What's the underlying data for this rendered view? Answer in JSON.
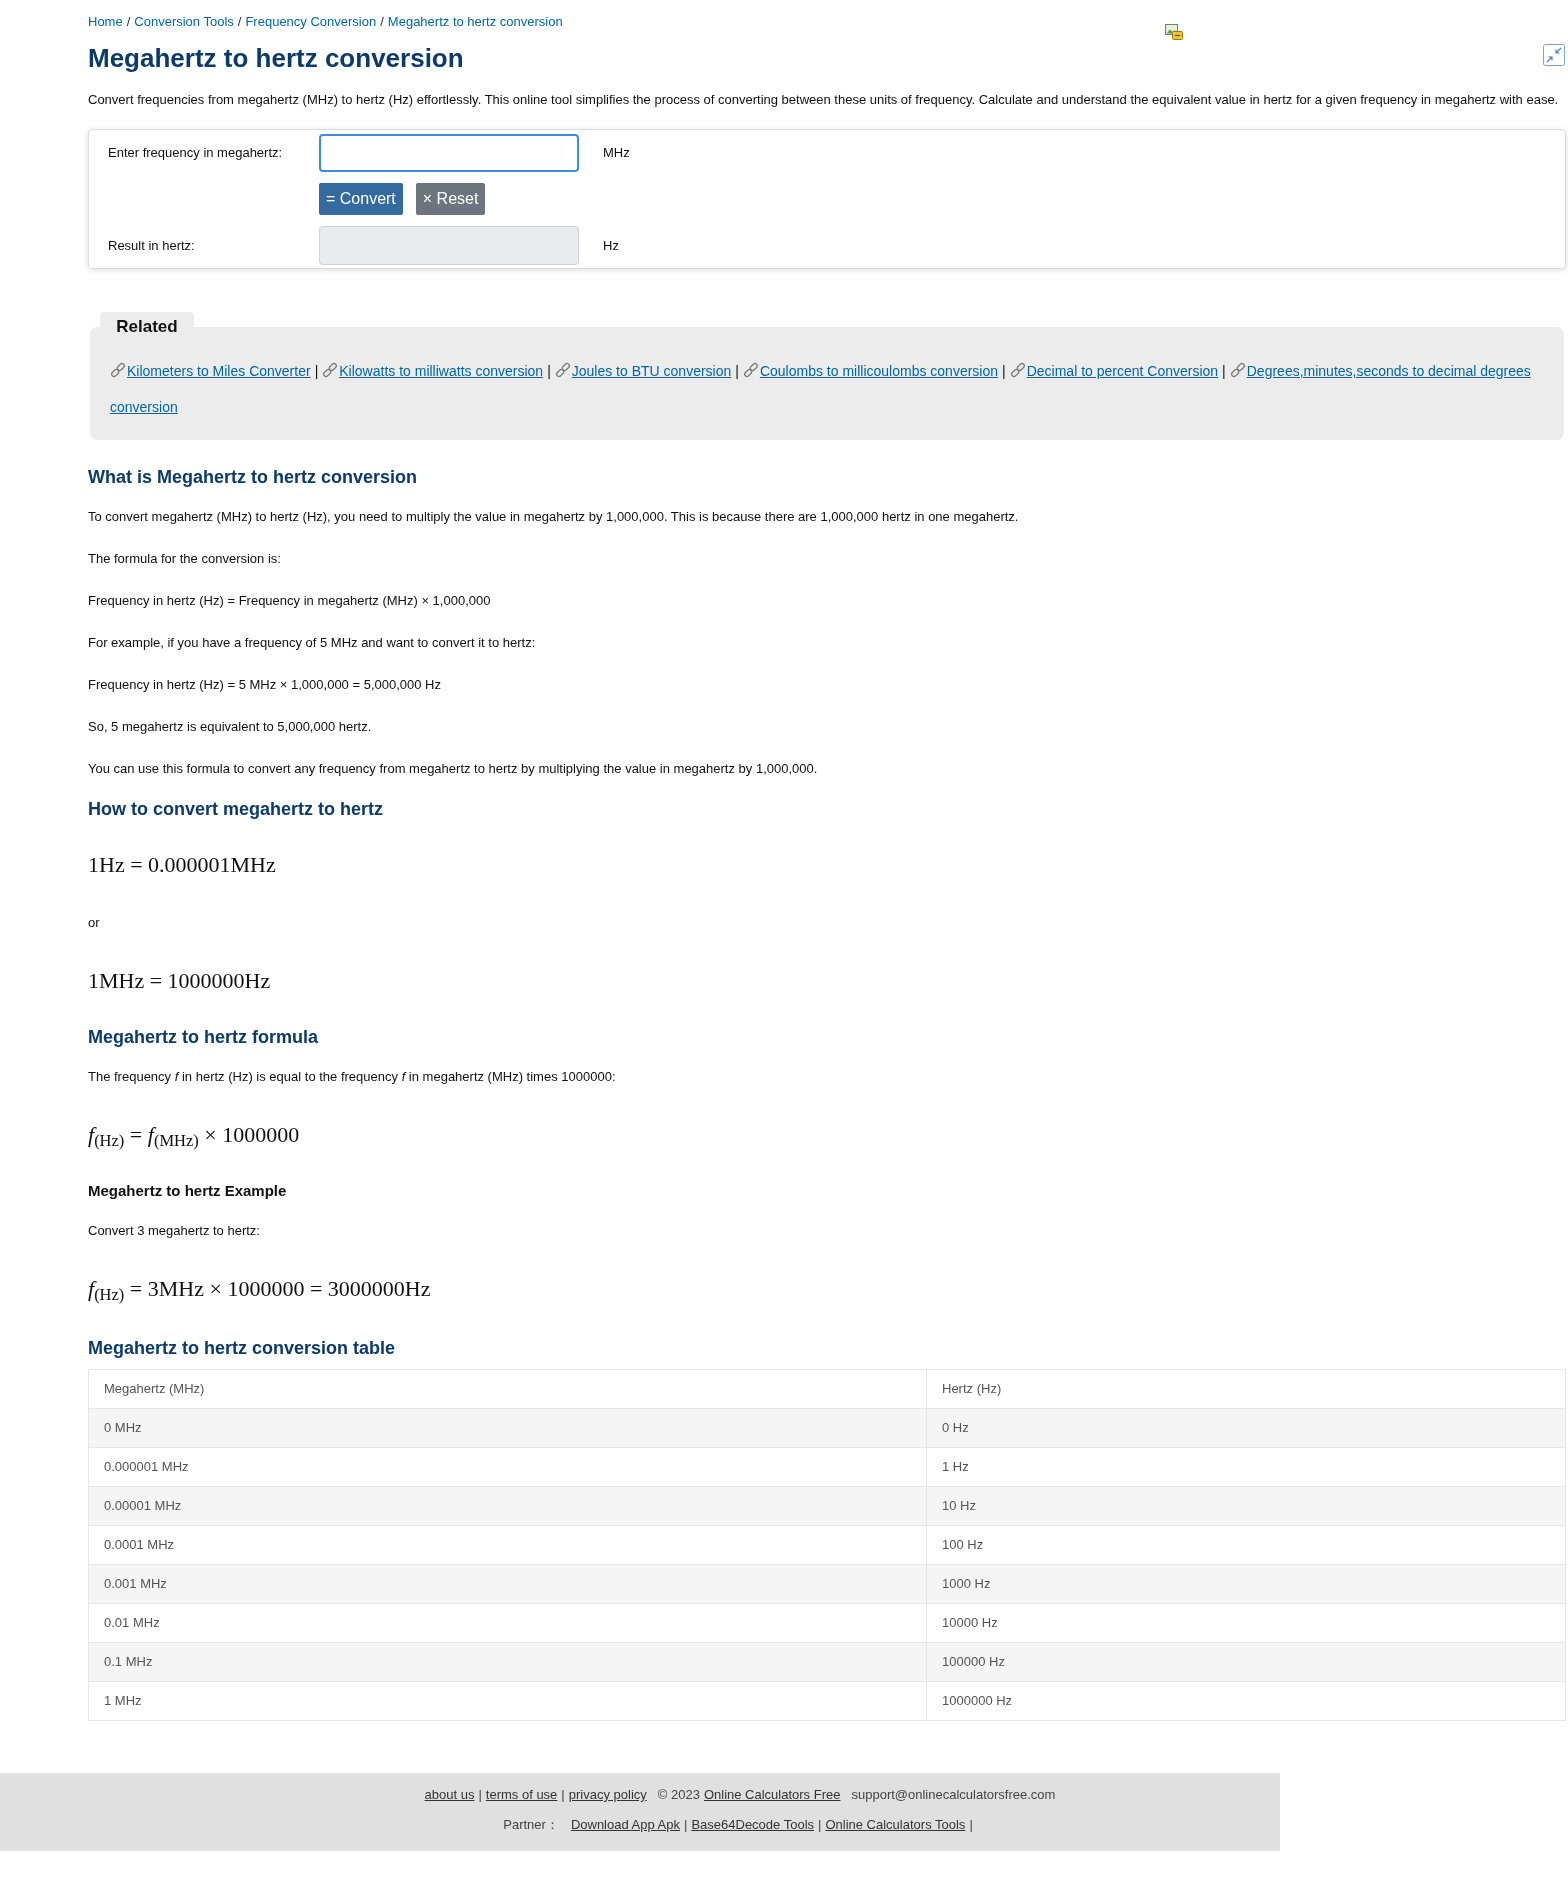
{
  "breadcrumb": {
    "items": [
      {
        "label": "Home"
      },
      {
        "label": "Conversion Tools"
      },
      {
        "label": "Frequency Conversion"
      },
      {
        "label": "Megahertz to hertz conversion"
      }
    ],
    "separators": [
      "/",
      "/",
      "/"
    ]
  },
  "title": "Megahertz to hertz conversion",
  "description": "Convert frequencies from megahertz (MHz) to hertz (Hz) effortlessly. This online tool simplifies the process of converting between these units of frequency. Calculate and understand the equivalent value in hertz for a given frequency in megahertz with ease.",
  "converter": {
    "input": {
      "label": "Enter frequency in megahertz:",
      "unit": "MHz",
      "focused": true
    },
    "buttons": [
      {
        "kind": "primary",
        "label": "= Convert"
      },
      {
        "kind": "secondary",
        "label": "× Reset"
      }
    ],
    "result": {
      "label": "Result in hertz:",
      "unit": "Hz",
      "readonly": true
    }
  },
  "related": {
    "title": "Related",
    "links": [
      {
        "label": "Kilometers to Miles Converter"
      },
      {
        "label": "Kilowatts to milliwatts conversion"
      },
      {
        "label": "Joules to BTU conversion"
      },
      {
        "label": "Coulombs to millicoulombs conversion"
      },
      {
        "label": "Decimal to percent Conversion"
      },
      {
        "label": "Degrees,minutes,seconds to decimal degrees",
        "label_continued": "conversion"
      }
    ],
    "separators": [
      "|",
      "|",
      "|",
      "|",
      "|"
    ]
  },
  "content": [
    {
      "kind": "heading",
      "text": "What is Megahertz to hertz conversion"
    },
    {
      "kind": "paragraph",
      "text": "To convert megahertz (MHz) to hertz (Hz), you need to multiply the value in megahertz by 1,000,000. This is because there are 1,000,000 hertz in one megahertz."
    },
    {
      "kind": "paragraph",
      "text": "The formula for the conversion is:"
    },
    {
      "kind": "paragraph",
      "text": "Frequency in hertz (Hz) = Frequency in megahertz (MHz) × 1,000,000"
    },
    {
      "kind": "paragraph",
      "text": "For example, if you have a frequency of 5 MHz and want to convert it to hertz:"
    },
    {
      "kind": "paragraph",
      "text": "Frequency in hertz (Hz) = 5 MHz × 1,000,000 = 5,000,000 Hz"
    },
    {
      "kind": "paragraph",
      "text": "So, 5 megahertz is equivalent to 5,000,000 hertz."
    },
    {
      "kind": "paragraph",
      "text": "You can use this formula to convert any frequency from megahertz to hertz by multiplying the value in megahertz by 1,000,000."
    },
    {
      "kind": "heading",
      "text": "How to convert megahertz to hertz"
    },
    {
      "kind": "formula",
      "text": "1Hz = 0.000001MHz"
    },
    {
      "kind": "paragraph",
      "text": "or"
    },
    {
      "kind": "formula",
      "text": "1MHz = 1000000Hz"
    },
    {
      "kind": "heading",
      "text": "Megahertz to hertz formula"
    },
    {
      "kind": "paragraph",
      "text": "The frequency *f* in hertz (Hz) is equal to the frequency *f* in megahertz (MHz) times 1000000:"
    },
    {
      "kind": "formula",
      "text": "*f*$_{(Hz)}$ = *f*$_{(MHz)}$ × 1000000"
    },
    {
      "kind": "subheading",
      "text": "Megahertz to hertz Example"
    },
    {
      "kind": "paragraph",
      "text": "Convert 3 megahertz to hertz:"
    },
    {
      "kind": "formula",
      "text": "*f*$_{(Hz)}$ = 3MHz × 1000000 = 3000000Hz"
    }
  ],
  "table": {
    "title": "Megahertz to hertz conversion table",
    "columns": [
      "Megahertz (MHz)",
      "Hertz (Hz)"
    ],
    "rows": [
      [
        "0 MHz",
        "0 Hz"
      ],
      [
        "0.000001 MHz",
        "1 Hz"
      ],
      [
        "0.00001 MHz",
        "10 Hz"
      ],
      [
        "0.0001 MHz",
        "100 Hz"
      ],
      [
        "0.001 MHz",
        "1000 Hz"
      ],
      [
        "0.01 MHz",
        "10000 Hz"
      ],
      [
        "0.1 MHz",
        "100000 Hz"
      ],
      [
        "1 MHz",
        "1000000 Hz"
      ]
    ]
  },
  "footer": {
    "links": [
      "about us",
      "terms of use",
      "privacy policy"
    ],
    "separators": [
      "|",
      "|"
    ],
    "copyright": "© 2023",
    "site_link": "Online Calculators Free",
    "email": "support@onlinecalculatorsfree.com",
    "partner_label": "Partner：",
    "partner_links": [
      "Download App Apk",
      "Base64Decode Tools",
      "Online Calculators Tools"
    ],
    "partner_separators": [
      "|",
      "|",
      "|"
    ]
  }
}
